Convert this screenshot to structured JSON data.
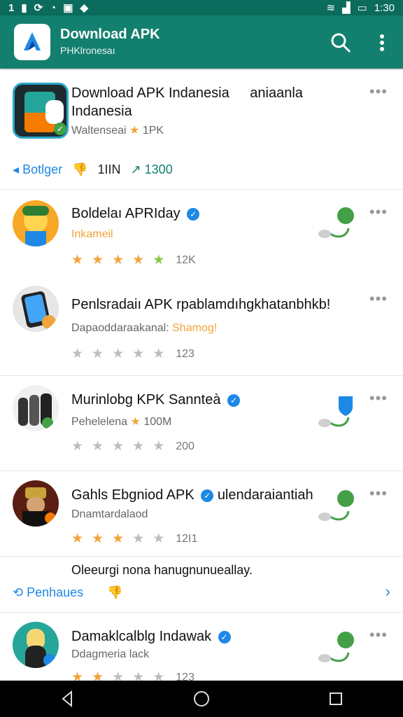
{
  "status": {
    "time": "1:30",
    "left_icons": [
      "1",
      "data-icon",
      "sync-icon",
      "alarm-icon",
      "gallery-icon",
      "location-icon"
    ]
  },
  "appbar": {
    "title": "Download APK",
    "subtitle": "PHKlronesaı"
  },
  "featured": {
    "title_line1": "Download APK Indanesia",
    "title_extra": "aniaanla",
    "title_line2": "Indanesia",
    "meta": "Waltenseai",
    "meta_count": "1PK",
    "actions": {
      "toggle": "Botlger",
      "mid": "1IIN",
      "trend": "1300"
    }
  },
  "items": [
    {
      "title": "Boldelaı APRIday",
      "subtitle": "Inkameil",
      "stars": [
        1,
        1,
        1,
        1,
        1
      ],
      "count": "12K"
    },
    {
      "title": "Penlsradaiı APK rpablamdıhgkhatanbhkb!",
      "subtitle": "Dapaoddaraakanal:",
      "subtitle_accent": "Shamog!",
      "stars": [
        1,
        1,
        1,
        0,
        0
      ],
      "count": "123"
    },
    {
      "title": "Murinlobg KPK Sannteà",
      "subtitle": "Pehelelena",
      "subtitle_count": "100M",
      "stars": [
        0,
        0,
        0,
        0,
        0
      ],
      "count": "200"
    },
    {
      "title": "Gahls Ebgniod APK",
      "title_extra": "ulendaraiantiah",
      "subtitle": "Dnamtardalaod",
      "stars": [
        1,
        1,
        1,
        0,
        0
      ],
      "count": "12I1"
    },
    {
      "title": "Damaklcalblg Indawak",
      "subtitle": "Ddagmeria lack",
      "stars": [
        1,
        1,
        0,
        0,
        0
      ],
      "count": "123"
    }
  ],
  "notice": {
    "text": "Oleeurgi nona hanugnunueallay.",
    "link": "Penhaues"
  }
}
